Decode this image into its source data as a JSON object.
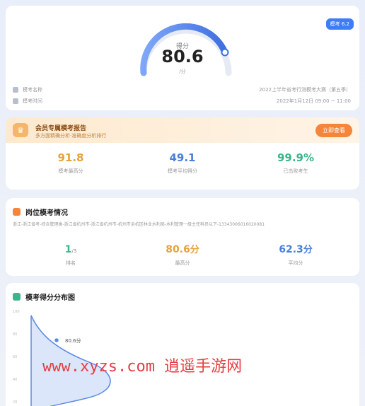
{
  "score_card": {
    "badge": "模考 6.2",
    "score_label": "得分",
    "score": "80.6",
    "score_unit": "/分",
    "meta": [
      {
        "label": "模考名称",
        "value": "2022上半年省考行测模考大赛（第五季）"
      },
      {
        "label": "模考时间",
        "value": "2022年1月12日 09:00 ~ 11:00"
      }
    ]
  },
  "member": {
    "title": "会员专属模考报告",
    "subtitle": "多方面精确分析·准确度分析排行",
    "button": "立即查看"
  },
  "stats": [
    {
      "value": "91.8",
      "label": "模考最高分",
      "color": "#e6a23c"
    },
    {
      "value": "49.1",
      "label": "模考平均得分",
      "color": "#4a7fd8"
    },
    {
      "value": "99.9%",
      "label": "已击败考生",
      "color": "#3bb58b"
    }
  ],
  "position": {
    "title": "岗位模考情况",
    "path": "浙江-浙江省考-综合管理类-浙江省杭州市-浙江省杭州市-杭州市余杭区林业水利局-水利管理一级主任科员以下-13343006016020081",
    "stats": [
      {
        "value": "1",
        "unit": "/3",
        "label": "排名",
        "color": "#3bb58b"
      },
      {
        "value": "80.6",
        "unit": "分",
        "label": "最高分",
        "color": "#e6a23c"
      },
      {
        "value": "62.3",
        "unit": "分",
        "label": "平均分",
        "color": "#4a7fd8"
      }
    ]
  },
  "distribution": {
    "title": "模考得分分布图",
    "marker_label": "80.6分"
  },
  "watermark": "www.xyzs.com 逍遥手游网",
  "colors": {
    "accent": "#3f7df6",
    "orange": "#f4853b",
    "gold": "#e6a23c",
    "green": "#3bb58b"
  }
}
